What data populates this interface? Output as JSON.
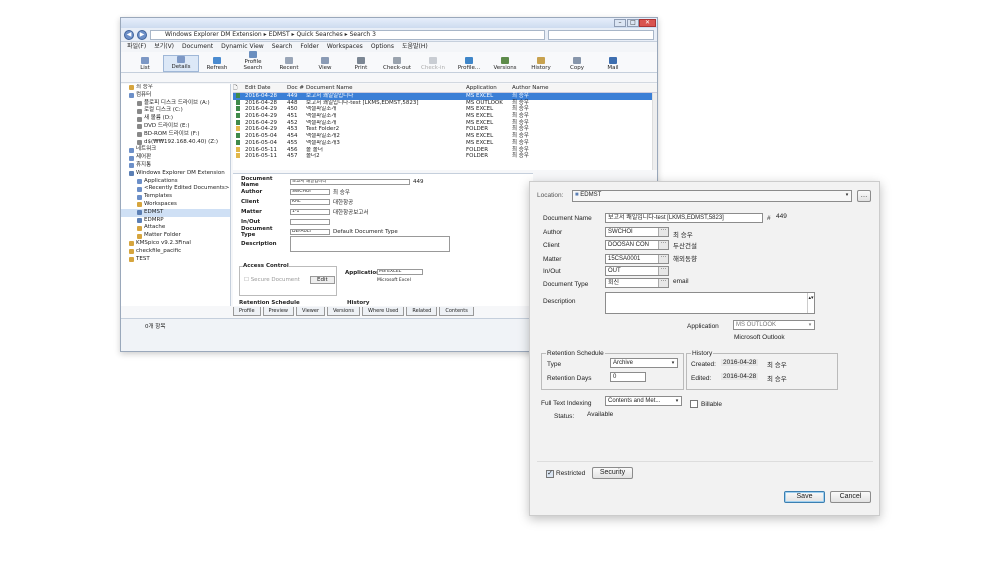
{
  "explorer": {
    "address": "Windows Explorer DM Extension ▸ EDMST ▸ Quick Searches ▸ Search 3",
    "menu": [
      "파일(F)",
      "보기(V)",
      "Document",
      "Dynamic View",
      "Search",
      "Folder",
      "Workspaces",
      "Options",
      "도움말(H)"
    ],
    "toolbar": [
      {
        "label": "List",
        "color": "#7d98c5",
        "state": "normal"
      },
      {
        "label": "Details",
        "color": "#7d98c5",
        "state": "active"
      },
      {
        "label": "Refresh",
        "color": "#4a8bd0",
        "state": "normal"
      },
      {
        "label": "Profile Search",
        "color": "#6b8fbf",
        "state": "normal"
      },
      {
        "label": "Recent",
        "color": "#9aa6b8",
        "state": "normal"
      },
      {
        "label": "View",
        "color": "#8a9bb5",
        "state": "normal"
      },
      {
        "label": "Print",
        "color": "#7c8794",
        "state": "normal"
      },
      {
        "label": "Check-out",
        "color": "#9aa3ae",
        "state": "normal"
      },
      {
        "label": "Check-in",
        "color": "#c9cdd3",
        "state": "disabled"
      },
      {
        "label": "Profile...",
        "color": "#3f86c9",
        "state": "normal"
      },
      {
        "label": "Versions",
        "color": "#5d8b4a",
        "state": "normal"
      },
      {
        "label": "History",
        "color": "#c8a24f",
        "state": "normal"
      },
      {
        "label": "Copy",
        "color": "#8796ab",
        "state": "normal"
      },
      {
        "label": "Mail",
        "color": "#3e6fb0",
        "state": "normal"
      }
    ],
    "tree": [
      {
        "label": "최 승우",
        "indent": 0,
        "color": "#d6a53e",
        "sel": false
      },
      {
        "label": "컴퓨터",
        "indent": 0,
        "color": "#6c8fc8",
        "sel": false
      },
      {
        "label": "플로피 디스크 드라이브 (A:)",
        "indent": 1,
        "color": "#888",
        "sel": false
      },
      {
        "label": "로컬 디스크 (C:)",
        "indent": 1,
        "color": "#888",
        "sel": false
      },
      {
        "label": "새 볼륨 (D:)",
        "indent": 1,
        "color": "#888",
        "sel": false
      },
      {
        "label": "DVD 드라이브 (E:)",
        "indent": 1,
        "color": "#888",
        "sel": false
      },
      {
        "label": "BD-ROM 드라이브 (F:)",
        "indent": 1,
        "color": "#888",
        "sel": false
      },
      {
        "label": "d$(₩₩192.168.40.40) (Z:)",
        "indent": 1,
        "color": "#888",
        "sel": false
      },
      {
        "label": "네트워크",
        "indent": 0,
        "color": "#6c8fc8",
        "sel": false
      },
      {
        "label": "제어판",
        "indent": 0,
        "color": "#6c8fc8",
        "sel": false
      },
      {
        "label": "휴지통",
        "indent": 0,
        "color": "#6c8fc8",
        "sel": false
      },
      {
        "label": "Windows Explorer DM Extension",
        "indent": 0,
        "color": "#5b7fb5",
        "sel": false
      },
      {
        "label": "Applications",
        "indent": 1,
        "color": "#6c8fc8",
        "sel": false
      },
      {
        "label": "<Recently Edited Documents>",
        "indent": 1,
        "color": "#6c8fc8",
        "sel": false
      },
      {
        "label": "Templates",
        "indent": 1,
        "color": "#6c8fc8",
        "sel": false
      },
      {
        "label": "Workspaces",
        "indent": 1,
        "color": "#d6a53e",
        "sel": false
      },
      {
        "label": "EDMST",
        "indent": 1,
        "color": "#5b7fb5",
        "sel": true
      },
      {
        "label": "EDMRP",
        "indent": 1,
        "color": "#5b7fb5",
        "sel": false
      },
      {
        "label": "Attache",
        "indent": 1,
        "color": "#d6a53e",
        "sel": false
      },
      {
        "label": "Matter Folder",
        "indent": 1,
        "color": "#d6a53e",
        "sel": false
      },
      {
        "label": "KMSpico v9.2.3Final",
        "indent": 0,
        "color": "#d6a53e",
        "sel": false
      },
      {
        "label": "checkfile_pacific",
        "indent": 0,
        "color": "#d6a53e",
        "sel": false
      },
      {
        "label": "TEST",
        "indent": 0,
        "color": "#d6a53e",
        "sel": false
      }
    ],
    "list_headers": [
      "Edit Date",
      "Doc #",
      "Document Name",
      "Application",
      "Author Name"
    ],
    "rows": [
      {
        "date": "2016-04-28",
        "num": "449",
        "name": "보고서 쾌일일입니다",
        "app": "MS EXCEL",
        "author": "최 승우",
        "sel": true
      },
      {
        "date": "2016-04-28",
        "num": "448",
        "name": "보고서 쾌일입니다-test [LKMS,EDMST,5823]",
        "app": "MS OUTLOOK",
        "author": "최 승우",
        "sel": false
      },
      {
        "date": "2016-04-29",
        "num": "450",
        "name": "액셀파일조개",
        "app": "MS EXCEL",
        "author": "최 승우",
        "sel": false
      },
      {
        "date": "2016-04-29",
        "num": "451",
        "name": "액셀파일조개",
        "app": "MS EXCEL",
        "author": "최 승우",
        "sel": false
      },
      {
        "date": "2016-04-29",
        "num": "452",
        "name": "액셀파일조개",
        "app": "MS EXCEL",
        "author": "최 승우",
        "sel": false
      },
      {
        "date": "2016-04-29",
        "num": "453",
        "name": "Test Folder2",
        "app": "FOLDER",
        "author": "최 승우",
        "sel": false
      },
      {
        "date": "2016-05-04",
        "num": "454",
        "name": "액셀파일조개2",
        "app": "MS EXCEL",
        "author": "최 승우",
        "sel": false
      },
      {
        "date": "2016-05-04",
        "num": "455",
        "name": "액셀파일조개3",
        "app": "MS EXCEL",
        "author": "최 승우",
        "sel": false
      },
      {
        "date": "2016-05-11",
        "num": "456",
        "name": "폴 폴더",
        "app": "FOLDER",
        "author": "최 승우",
        "sel": false
      },
      {
        "date": "2016-05-11",
        "num": "457",
        "name": "폴더2",
        "app": "FOLDER",
        "author": "최 승우",
        "sel": false
      }
    ],
    "profile": {
      "doc_name_label": "Document Name",
      "doc_name": "보고서 쾌일입니다",
      "doc_num": "449",
      "author_label": "Author",
      "author": "SWCHOI",
      "author_name": "최 승우",
      "client_label": "Client",
      "client": "KAL",
      "client_name": "대한항공",
      "matter_label": "Matter",
      "matter": "1-1",
      "matter_name": "대한항공보고서",
      "inout_label": "In/Out",
      "inout": "",
      "doctype_label": "Document Type",
      "doctype": "DEFAULT",
      "doctype_name": "Default Document Type",
      "desc_label": "Description",
      "access_label": "Access Control",
      "secure_label": "Secure Document",
      "edit_label": "Edit",
      "app_label": "Application",
      "app": "MS EXCEL",
      "app_name": "Microsoft Excel",
      "retention_label": "Retention Schedule",
      "history_label": "History"
    },
    "tabs": [
      "Profile",
      "Preview",
      "Viewer",
      "Versions",
      "Where Used",
      "Related",
      "Contents"
    ],
    "status": "0개 항목"
  },
  "dialog": {
    "location_label": "Location:",
    "location": "EDMST",
    "doc_name_label": "Document Name",
    "doc_name": "보고서 쾌일입니다-test [LKMS,EDMST,5823]",
    "doc_num_prefix": "#",
    "doc_num": "449",
    "author_label": "Author",
    "author": "SWCHOI",
    "author_name": "최 승우",
    "client_label": "Client",
    "client": "DOOSAN CON",
    "client_name": "두산건설",
    "matter_label": "Matter",
    "matter": "15CSA0001",
    "matter_name": "해외동향",
    "inout_label": "In/Out",
    "inout": "OUT",
    "doctype_label": "Document Type",
    "doctype": "회신",
    "doctype_name": "email",
    "desc_label": "Description",
    "app_label": "Application",
    "app": "MS OUTLOOK",
    "app_name": "Microsoft Outlook",
    "retention": {
      "title": "Retention Schedule",
      "type_label": "Type",
      "type": "Archive",
      "days_label": "Retention Days",
      "days": "0"
    },
    "history": {
      "title": "History",
      "created_label": "Created:",
      "created": "2016-04-28",
      "created_by": "최 승우",
      "edited_label": "Edited:",
      "edited": "2016-04-28",
      "edited_by": "최 승우"
    },
    "fti_label": "Full Text Indexing",
    "fti": "Contents and Met...",
    "billable_label": "Billable",
    "status_label": "Status:",
    "status": "Available",
    "restricted_label": "Restricted",
    "security_label": "Security",
    "save_label": "Save",
    "cancel_label": "Cancel"
  }
}
